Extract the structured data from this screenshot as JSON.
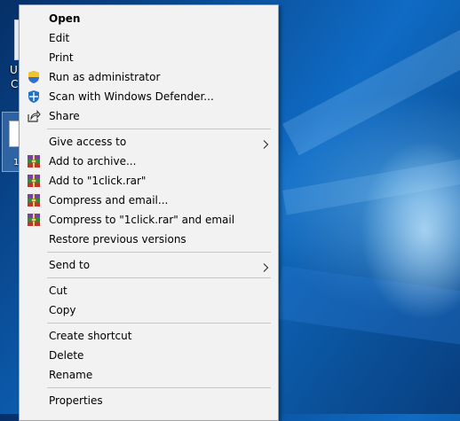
{
  "desktop": {
    "icon_label_fragment_1": "U",
    "icon_label_fragment_2": "C",
    "icon_label_fragment_3": "1"
  },
  "context_menu": {
    "groups": [
      [
        {
          "label": "Open",
          "bold": true,
          "icon": null
        },
        {
          "label": "Edit",
          "icon": null
        },
        {
          "label": "Print",
          "icon": null
        },
        {
          "label": "Run as administrator",
          "icon": "uac-shield-icon"
        },
        {
          "label": "Scan with Windows Defender...",
          "icon": "windows-defender-icon"
        },
        {
          "label": "Share",
          "icon": "share-icon"
        }
      ],
      [
        {
          "label": "Give access to",
          "icon": null,
          "submenu": true
        },
        {
          "label": "Add to archive...",
          "icon": "winrar-icon"
        },
        {
          "label": "Add to \"1click.rar\"",
          "icon": "winrar-icon"
        },
        {
          "label": "Compress and email...",
          "icon": "winrar-icon"
        },
        {
          "label": "Compress to \"1click.rar\" and email",
          "icon": "winrar-icon"
        },
        {
          "label": "Restore previous versions",
          "icon": null
        }
      ],
      [
        {
          "label": "Send to",
          "icon": null,
          "submenu": true
        }
      ],
      [
        {
          "label": "Cut",
          "icon": null
        },
        {
          "label": "Copy",
          "icon": null
        }
      ],
      [
        {
          "label": "Create shortcut",
          "icon": null
        },
        {
          "label": "Delete",
          "icon": null
        },
        {
          "label": "Rename",
          "icon": null
        }
      ],
      [
        {
          "label": "Properties",
          "icon": null
        }
      ]
    ]
  },
  "colors": {
    "menu_background": "#f2f2f2",
    "separator": "#c8c8c8",
    "desktop_accent": "#0f6bc4"
  }
}
